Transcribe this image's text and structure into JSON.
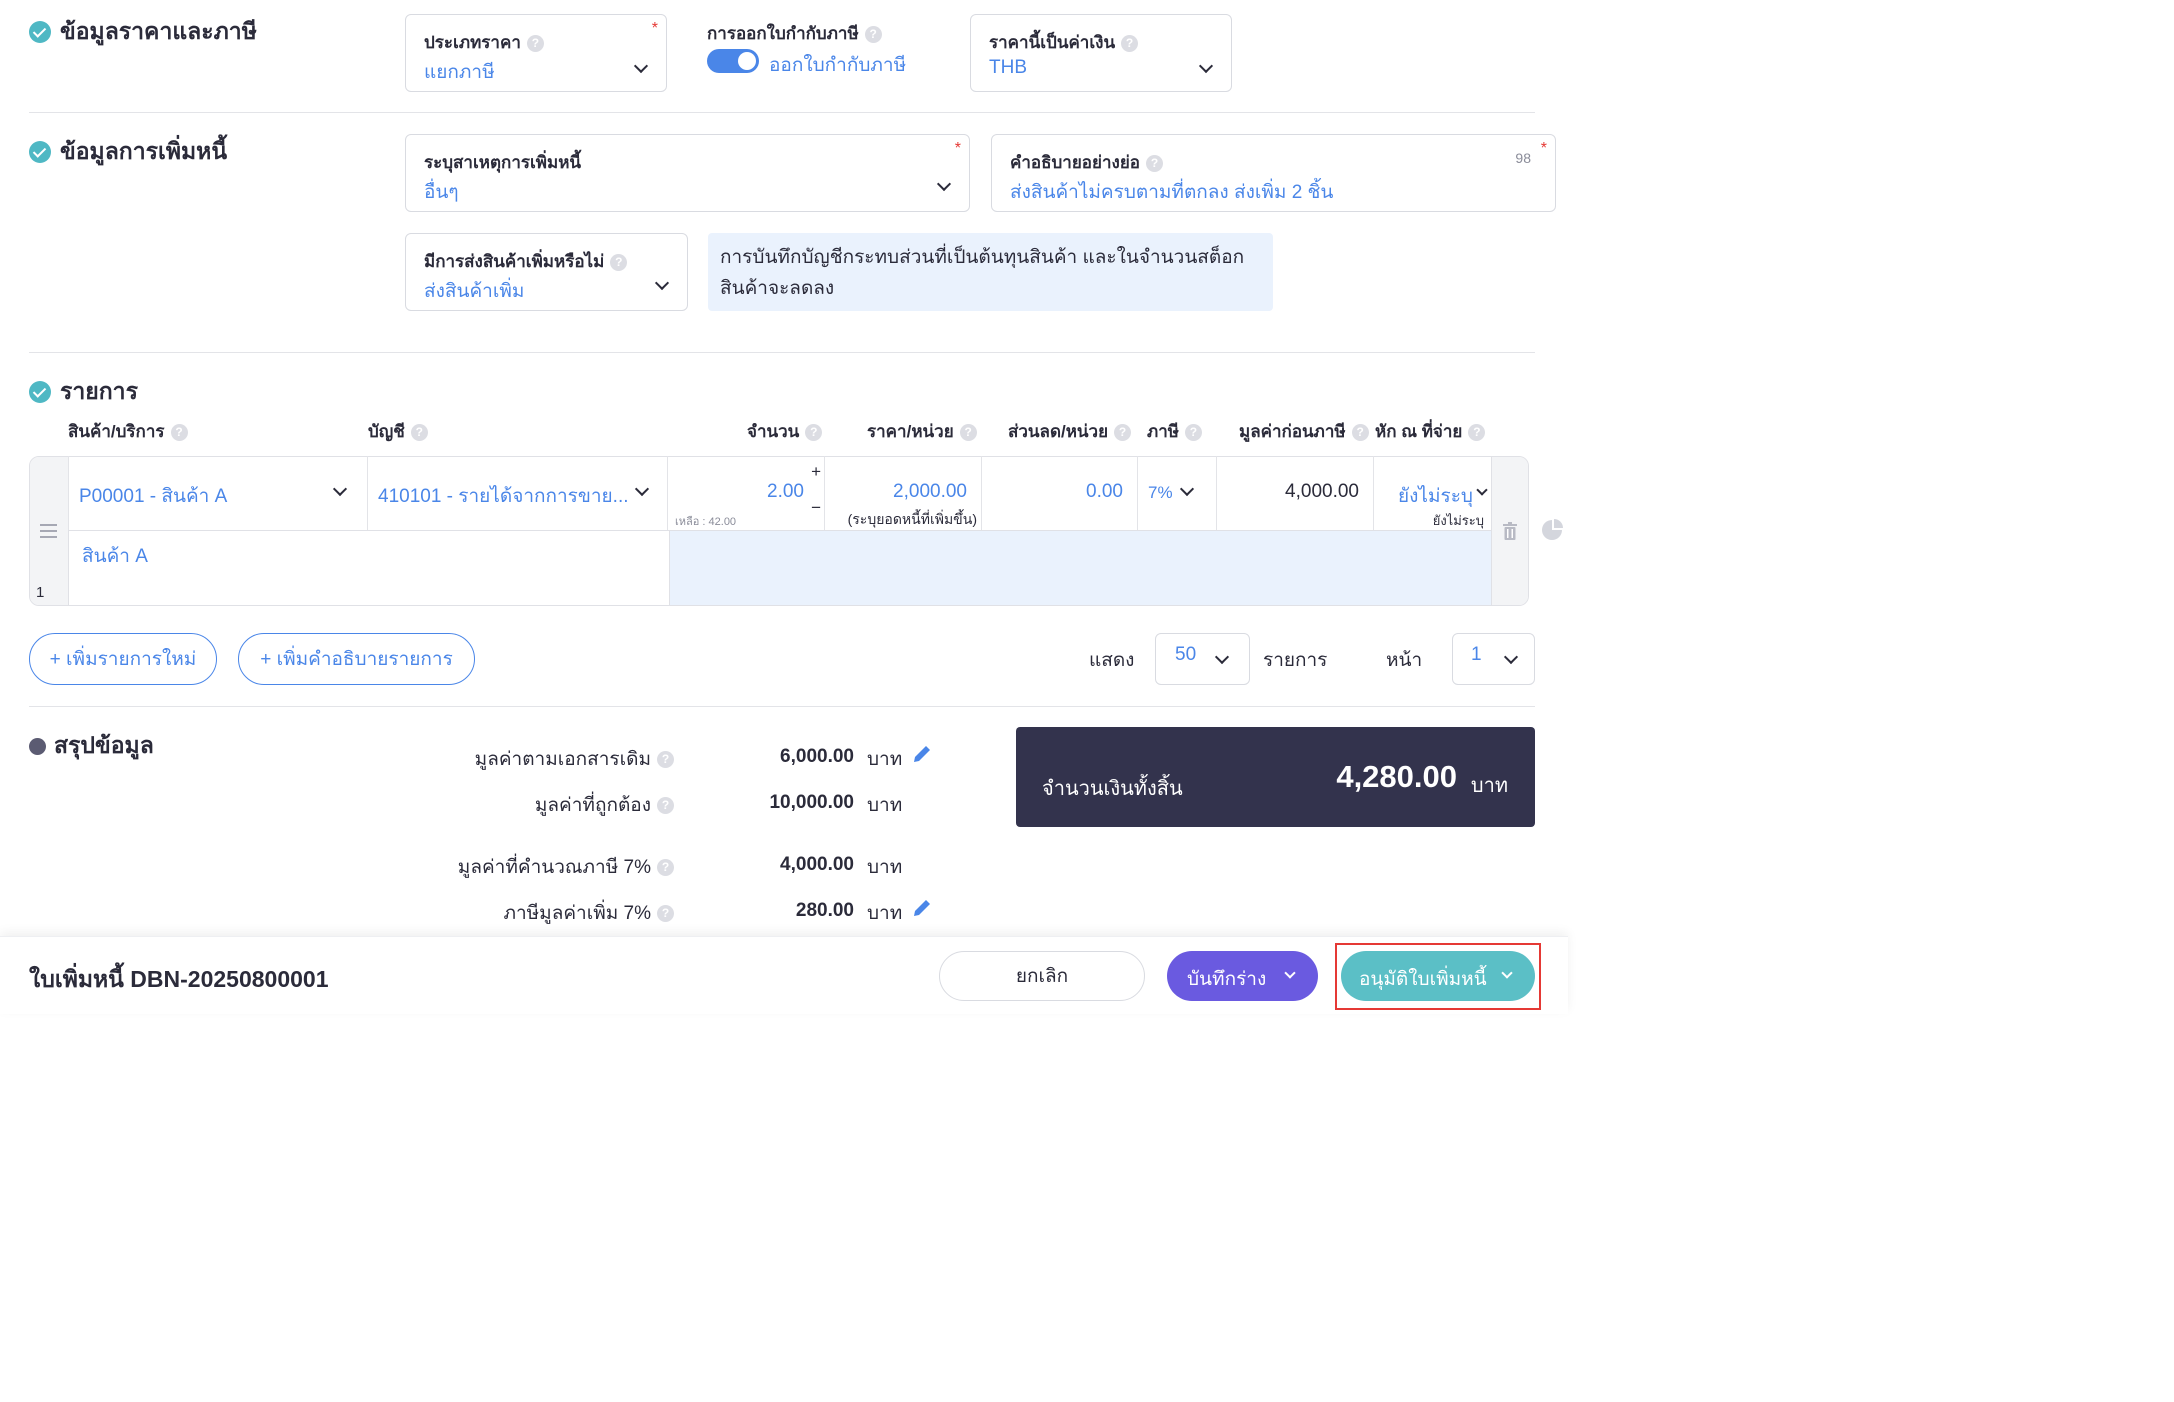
{
  "sections": {
    "price_tax": "ข้อมูลราคาและภาษี",
    "debit_info": "ข้อมูลการเพิ่มหนี้",
    "items": "รายการ",
    "summary": "สรุปข้อมูล"
  },
  "price_tax": {
    "price_type_label": "ประเภทราคา",
    "price_type_value": "แยกภาษี",
    "tax_invoice_label": "การออกใบกำกับภาษี",
    "tax_invoice_value": "ออกใบกำกับภาษี",
    "tax_invoice_on": true,
    "currency_label": "ราคานี้เป็นค่าเงิน",
    "currency_value": "THB"
  },
  "debit_info": {
    "reason_label": "ระบุสาเหตุการเพิ่มหนี้",
    "reason_value": "อื่นๆ",
    "desc_label": "คำอธิบายอย่างย่อ",
    "desc_counter": "98",
    "desc_value": "ส่งสินค้าไม่ครบตามที่ตกลง ส่งเพิ่ม 2 ชิ้น",
    "extra_goods_label": "มีการส่งสินค้าเพิ่มหรือไม่",
    "extra_goods_value": "ส่งสินค้าเพิ่ม",
    "info_note": "การบันทึกบัญชีกระทบส่วนที่เป็นต้นทุนสินค้า และในจำนวนสต็อกสินค้าจะลดลง"
  },
  "table": {
    "headers": {
      "product": "สินค้า/บริการ",
      "account": "บัญชี",
      "qty": "จำนวน",
      "unit_price": "ราคา/หน่วย",
      "discount": "ส่วนลด/หน่วย",
      "tax": "ภาษี",
      "pre_tax": "มูลค่าก่อนภาษี",
      "withholding": "หัก ณ ที่จ่าย"
    },
    "row": {
      "index": "1",
      "product": "P00001 - สินค้า A",
      "account": "410101 - รายได้จากการขาย...",
      "qty": "2.00",
      "remaining": "เหลือ : 42.00",
      "unit_price": "2,000.00",
      "unit_price_note": "(ระบุยอดหนี้ที่เพิ่มขึ้น)",
      "discount": "0.00",
      "tax": "7%",
      "pre_tax": "4,000.00",
      "withholding": "ยังไม่ระบุ",
      "withholding_sub": "ยังไม่ระบุ",
      "description": "สินค้า A"
    }
  },
  "actions": {
    "add_item": "+ เพิ่มรายการใหม่",
    "add_desc": "+ เพิ่มคำอธิบายรายการ",
    "show_label": "แสดง",
    "per_page": "50",
    "items_label": "รายการ",
    "page_label": "หน้า",
    "page": "1"
  },
  "summary": {
    "original_label": "มูลค่าตามเอกสารเดิม",
    "original_value": "6,000.00",
    "correct_label": "มูลค่าที่ถูกต้อง",
    "correct_value": "10,000.00",
    "taxable_label": "มูลค่าที่คำนวณภาษี 7%",
    "taxable_value": "4,000.00",
    "vat_label": "ภาษีมูลค่าเพิ่ม 7%",
    "vat_value": "280.00",
    "currency": "บาท",
    "total_label": "จำนวนเงินทั้งสิ้น",
    "total_value": "4,280.00"
  },
  "footer": {
    "doc_title": "ใบเพิ่มหนี้ DBN-20250800001",
    "cancel": "ยกเลิก",
    "save_draft": "บันทึกร่าง",
    "approve": "อนุมัติใบเพิ่มหนี้"
  },
  "colors": {
    "accent_blue": "#4a86e8",
    "check_teal": "#4fb8c4",
    "draft_purple": "#6a5ae0",
    "approve_teal": "#5bbfc6",
    "total_bg": "#33334d",
    "highlight_red": "#e53935"
  }
}
